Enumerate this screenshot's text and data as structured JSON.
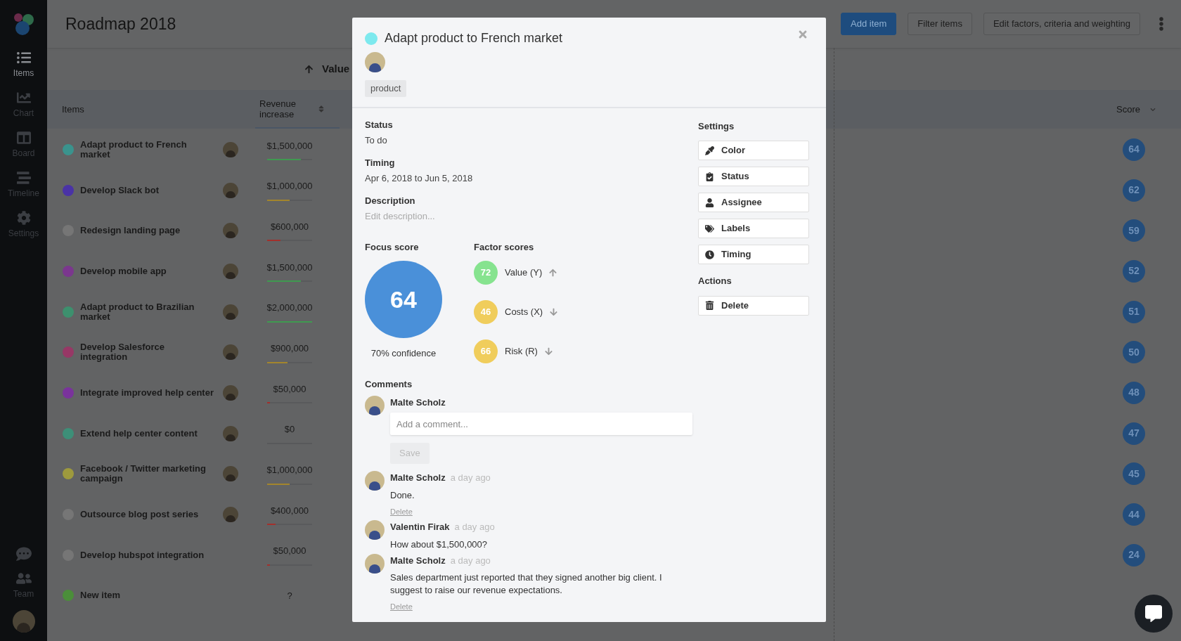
{
  "sidebar": {
    "nav": [
      {
        "kind": "list",
        "label": "Items",
        "selected": true
      },
      {
        "kind": "chart",
        "label": "Chart",
        "selected": false
      },
      {
        "kind": "board",
        "label": "Board",
        "selected": false
      },
      {
        "kind": "timeline",
        "label": "Timeline",
        "selected": false
      },
      {
        "kind": "settings",
        "label": "Settings",
        "selected": false
      }
    ],
    "bottom": [
      {
        "kind": "help"
      },
      {
        "kind": "team",
        "label": "Team"
      }
    ]
  },
  "header": {
    "title": "Roadmap 2018",
    "buttons": [
      {
        "kind": "primary",
        "label": "Add item"
      },
      {
        "kind": "outline",
        "label": "Filter items"
      },
      {
        "kind": "outline",
        "label": "Edit factors, criteria and weighting"
      }
    ]
  },
  "factor_group": {
    "label": "Value",
    "kind": "up"
  },
  "table": {
    "columns": [
      "Items",
      "Revenue increase",
      "Score"
    ],
    "rows": [
      {
        "name": "Adapt product to French market",
        "color": "#3a938d",
        "assigned": true,
        "revenue": "$1,500,000",
        "bar": {
          "level": 0.75,
          "color": "#3f9a50"
        },
        "score": "64"
      },
      {
        "name": "Develop Slack bot",
        "color": "#4a33a6",
        "assigned": true,
        "revenue": "$1,000,000",
        "bar": {
          "level": 0.5,
          "color": "#a3852c"
        },
        "score": "62"
      },
      {
        "name": "Redesign landing page",
        "color": "#767676",
        "assigned": true,
        "revenue": "$600,000",
        "bar": {
          "level": 0.3,
          "color": "#a2302c"
        },
        "score": "59"
      },
      {
        "name": "Develop mobile app",
        "color": "#7b378e",
        "assigned": true,
        "revenue": "$1,500,000",
        "bar": {
          "level": 0.75,
          "color": "#3f9a50"
        },
        "score": "52"
      },
      {
        "name": "Adapt product to Brazilian market",
        "color": "#3d906e",
        "assigned": true,
        "revenue": "$2,000,000",
        "bar": {
          "level": 1,
          "color": "#3f9a50"
        },
        "score": "51"
      },
      {
        "name": "Develop Salesforce integration",
        "color": "#973866",
        "assigned": true,
        "revenue": "$900,000",
        "bar": {
          "level": 0.45,
          "color": "#a3852c"
        },
        "score": "50"
      },
      {
        "name": "Integrate improved help center",
        "color": "#7a339c",
        "assigned": true,
        "revenue": "$50,000",
        "bar": {
          "level": 0.02,
          "color": "#a2302c"
        },
        "score": "48"
      },
      {
        "name": "Extend help center content",
        "color": "#3d8f78",
        "assigned": true,
        "revenue": "$0",
        "bar": {},
        "score": "47"
      },
      {
        "name": "Facebook / Twitter marketing campaign",
        "color": "#9e9a3d",
        "assigned": true,
        "revenue": "$1,000,000",
        "bar": {
          "level": 0.5,
          "color": "#a3852c"
        },
        "score": "45"
      },
      {
        "name": "Outsource blog post series",
        "color": "#767676",
        "assigned": true,
        "revenue": "$400,000",
        "bar": {
          "level": 0.18,
          "color": "#a2302c"
        },
        "score": "44"
      },
      {
        "name": "Develop hubspot integration",
        "color": "#767676",
        "assigned": false,
        "revenue": "$50,000",
        "bar": {
          "level": 0.02,
          "color": "#a2302c"
        },
        "score": "24"
      },
      {
        "name": "New item",
        "color": "#4b8e3a",
        "assigned": false,
        "revenue": "?",
        "score": ""
      }
    ]
  },
  "modal": {
    "title": "Adapt product to French market",
    "color": "#7de9ee",
    "label": "product",
    "fields": [
      {
        "label": "Status",
        "value": "To do",
        "kind": "text"
      },
      {
        "label": "Timing",
        "value": "Apr 6, 2018 to Jun 5, 2018",
        "kind": "text"
      },
      {
        "label": "Description",
        "placeholder": "Edit description...",
        "kind": "field"
      }
    ],
    "focus": {
      "label": "Focus score",
      "score": "64",
      "confidence": "70% confidence"
    },
    "factors": {
      "label": "Factor scores",
      "items": [
        {
          "score": "72",
          "name": "Value (Y)",
          "color": "#86e38f",
          "kind": "up"
        },
        {
          "score": "46",
          "name": "Costs (X)",
          "color": "#f0cd5c",
          "kind": "down"
        },
        {
          "score": "66",
          "name": "Risk (R)",
          "color": "#f0cd5c",
          "kind": "down"
        }
      ]
    },
    "settings": {
      "label": "Settings",
      "buttons": [
        {
          "kind": "color",
          "label": "Color"
        },
        {
          "kind": "status",
          "label": "Status"
        },
        {
          "kind": "assignee",
          "label": "Assignee"
        },
        {
          "kind": "labels",
          "label": "Labels"
        },
        {
          "kind": "timing",
          "label": "Timing"
        }
      ]
    },
    "actions": {
      "label": "Actions",
      "buttons": [
        {
          "kind": "delete",
          "label": "Delete"
        }
      ]
    },
    "comments": {
      "label": "Comments",
      "form": {
        "author": "Malte Scholz",
        "placeholder": "Add a comment...",
        "save": "Save",
        "disabled": true
      },
      "items": [
        {
          "author": "Malte Scholz",
          "time": "a day ago",
          "text": "Done.",
          "delete": "Delete"
        },
        {
          "author": "Valentin Firak",
          "time": "a day ago",
          "text": "How about $1,500,000?"
        },
        {
          "author": "Malte Scholz",
          "time": "a day ago",
          "text": "Sales department just reported that they signed another big client. I suggest to raise our revenue expectations.",
          "delete": "Delete"
        }
      ]
    }
  }
}
